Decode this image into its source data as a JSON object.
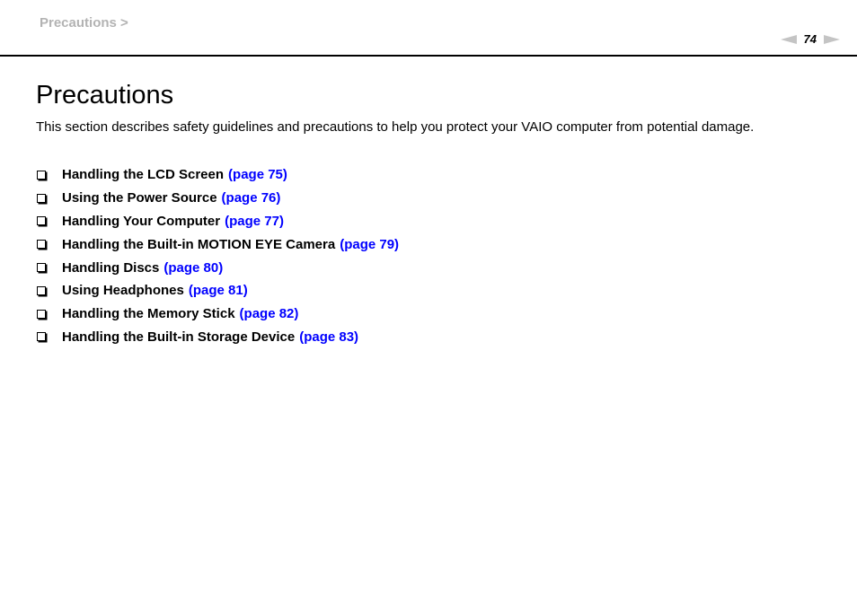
{
  "header": {
    "breadcrumb": "Precautions >",
    "page_number": "74",
    "prev_icon": "prev-page-arrow-icon",
    "next_icon": "next-page-arrow-icon"
  },
  "main": {
    "title": "Precautions",
    "intro": "This section describes safety guidelines and precautions to help you protect your VAIO computer from potential damage.",
    "toc": [
      {
        "label": "Handling the LCD Screen",
        "link": "(page 75)"
      },
      {
        "label": "Using the Power Source",
        "link": "(page 76)"
      },
      {
        "label": "Handling Your Computer",
        "link": "(page 77)"
      },
      {
        "label": "Handling the Built-in MOTION EYE Camera",
        "link": "(page 79)"
      },
      {
        "label": "Handling Discs",
        "link": "(page 80)"
      },
      {
        "label": "Using Headphones",
        "link": "(page 81)"
      },
      {
        "label": "Handling the Memory Stick",
        "link": "(page 82)"
      },
      {
        "label": "Handling the Built-in Storage Device",
        "link": "(page 83)"
      }
    ]
  },
  "colors": {
    "link": "#0000ff",
    "breadcrumb": "#b3b3b3",
    "pager_arrow": "#c4c4c4"
  }
}
